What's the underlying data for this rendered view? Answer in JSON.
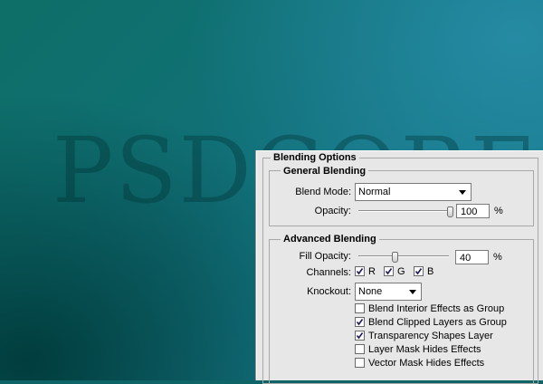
{
  "canvas": {
    "watermark": "PSDCORE"
  },
  "panel": {
    "title": "Blending Options",
    "general": {
      "title": "General Blending",
      "blend_mode_label": "Blend Mode:",
      "blend_mode_value": "Normal",
      "opacity_label": "Opacity:",
      "opacity_value": "100",
      "opacity_unit": "%",
      "opacity_level": 100
    },
    "advanced": {
      "title": "Advanced Blending",
      "fill_opacity_label": "Fill Opacity:",
      "fill_opacity_value": "40",
      "fill_opacity_unit": "%",
      "fill_opacity_level": 40,
      "channels_label": "Channels:",
      "channels": [
        {
          "label": "R",
          "checked": true
        },
        {
          "label": "G",
          "checked": true
        },
        {
          "label": "B",
          "checked": true
        }
      ],
      "knockout_label": "Knockout:",
      "knockout_value": "None",
      "options": [
        {
          "label": "Blend Interior Effects as Group",
          "checked": false
        },
        {
          "label": "Blend Clipped Layers as Group",
          "checked": true
        },
        {
          "label": "Transparency Shapes Layer",
          "checked": true
        },
        {
          "label": "Layer Mask Hides Effects",
          "checked": false
        },
        {
          "label": "Vector Mask Hides Effects",
          "checked": false
        }
      ]
    }
  }
}
